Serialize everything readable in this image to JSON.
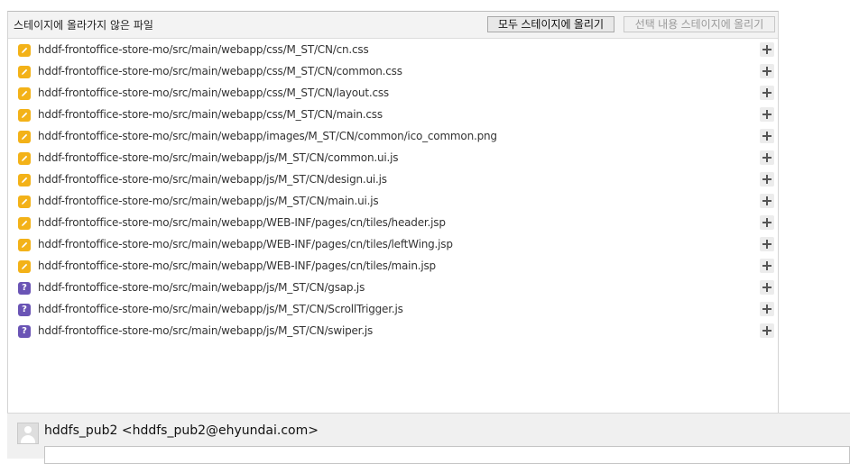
{
  "unstaged": {
    "title": "스테이지에 올라가지 않은 파일",
    "stage_all_label": "모두 스테이지에 올리기",
    "stage_selected_label": "선택 내용 스테이지에 올리기",
    "files": [
      {
        "status": "modified",
        "status_icon": "pencil-icon",
        "path": "hddf-frontoffice-store-mo/src/main/webapp/css/M_ST/CN/cn.css"
      },
      {
        "status": "modified",
        "status_icon": "pencil-icon",
        "path": "hddf-frontoffice-store-mo/src/main/webapp/css/M_ST/CN/common.css"
      },
      {
        "status": "modified",
        "status_icon": "pencil-icon",
        "path": "hddf-frontoffice-store-mo/src/main/webapp/css/M_ST/CN/layout.css"
      },
      {
        "status": "modified",
        "status_icon": "pencil-icon",
        "path": "hddf-frontoffice-store-mo/src/main/webapp/css/M_ST/CN/main.css"
      },
      {
        "status": "modified",
        "status_icon": "pencil-icon",
        "path": "hddf-frontoffice-store-mo/src/main/webapp/images/M_ST/CN/common/ico_common.png"
      },
      {
        "status": "modified",
        "status_icon": "pencil-icon",
        "path": "hddf-frontoffice-store-mo/src/main/webapp/js/M_ST/CN/common.ui.js"
      },
      {
        "status": "modified",
        "status_icon": "pencil-icon",
        "path": "hddf-frontoffice-store-mo/src/main/webapp/js/M_ST/CN/design.ui.js"
      },
      {
        "status": "modified",
        "status_icon": "pencil-icon",
        "path": "hddf-frontoffice-store-mo/src/main/webapp/js/M_ST/CN/main.ui.js"
      },
      {
        "status": "modified",
        "status_icon": "pencil-icon",
        "path": "hddf-frontoffice-store-mo/src/main/webapp/WEB-INF/pages/cn/tiles/header.jsp"
      },
      {
        "status": "modified",
        "status_icon": "pencil-icon",
        "path": "hddf-frontoffice-store-mo/src/main/webapp/WEB-INF/pages/cn/tiles/leftWing.jsp"
      },
      {
        "status": "modified",
        "status_icon": "pencil-icon",
        "path": "hddf-frontoffice-store-mo/src/main/webapp/WEB-INF/pages/cn/tiles/main.jsp"
      },
      {
        "status": "untracked",
        "status_icon": "question-icon",
        "symbol": "?",
        "path": "hddf-frontoffice-store-mo/src/main/webapp/js/M_ST/CN/gsap.js"
      },
      {
        "status": "untracked",
        "status_icon": "question-icon",
        "symbol": "?",
        "path": "hddf-frontoffice-store-mo/src/main/webapp/js/M_ST/CN/ScrollTrigger.js"
      },
      {
        "status": "untracked",
        "status_icon": "question-icon",
        "symbol": "?",
        "path": "hddf-frontoffice-store-mo/src/main/webapp/js/M_ST/CN/swiper.js"
      }
    ],
    "add_icon": "plus-icon"
  },
  "commit": {
    "author": "hddfs_pub2 <hddfs_pub2@ehyundai.com>",
    "avatar_icon": "user-avatar-icon"
  },
  "colors": {
    "modified": "#f3b218",
    "untracked": "#6a54b5"
  }
}
